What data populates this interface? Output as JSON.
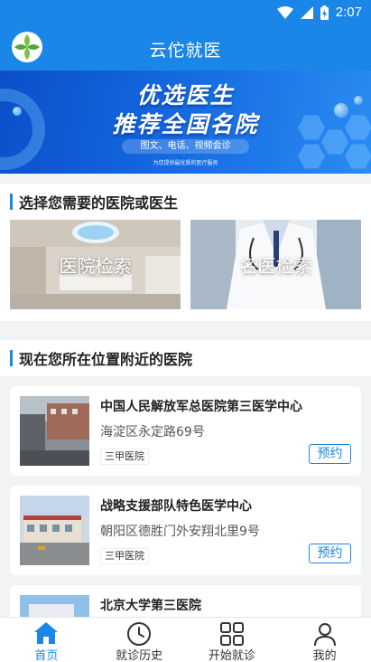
{
  "status_bar": {
    "time": "2:07"
  },
  "app_bar": {
    "title": "云佗就医"
  },
  "banner": {
    "headline_1": "优选医生",
    "headline_2": "推荐全国名院",
    "subtitle": "图文、电话、视频会诊",
    "tagline": "为您提供最优质的医疗服务"
  },
  "search_section": {
    "title": "选择您需要的医院或医生",
    "hospital_search": "医院检索",
    "doctor_search": "名医检索"
  },
  "nearby_section": {
    "title": "现在您所在位置附近的医院",
    "hospitals": [
      {
        "name": "中国人民解放军总医院第三医学中心",
        "address": "海淀区永定路69号",
        "level": "三甲医院",
        "action": "预约"
      },
      {
        "name": "战略支援部队特色医学中心",
        "address": "朝阳区德胜门外安翔北里9号",
        "level": "三甲医院",
        "action": "预约"
      },
      {
        "name": "北京大学第三医院"
      }
    ]
  },
  "tab_bar": {
    "items": [
      {
        "label": "首页",
        "icon": "home-icon",
        "active": true
      },
      {
        "label": "就诊历史",
        "icon": "clock-icon",
        "active": false
      },
      {
        "label": "开始就诊",
        "icon": "grid-icon",
        "active": false
      },
      {
        "label": "我的",
        "icon": "person-icon",
        "active": false
      }
    ]
  },
  "colors": {
    "primary": "#1a86e8",
    "background": "#f2f3f5"
  }
}
